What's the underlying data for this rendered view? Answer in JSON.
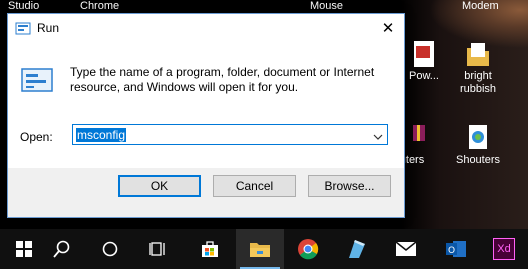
{
  "desktop": {
    "top_labels": [
      "Studio",
      "Chrome",
      "Mouse",
      "Modem"
    ],
    "icons": [
      {
        "label": "Pow...",
        "icon": "pdf-file-icon"
      },
      {
        "label": "bright rubbish",
        "icon": "folder-icon"
      },
      {
        "label": "uters",
        "icon": "archive-file-icon"
      },
      {
        "label": "Shouters",
        "icon": "web-document-icon"
      }
    ]
  },
  "run_dialog": {
    "title": "Run",
    "close_label": "✕",
    "description": "Type the name of a program, folder, document or Internet resource, and Windows will open it for you.",
    "open_label": "Open:",
    "open_value": "msconfig",
    "ok_label": "OK",
    "cancel_label": "Cancel",
    "browse_label": "Browse..."
  },
  "taskbar": {
    "items": [
      "start-icon",
      "search-icon",
      "cortana-icon",
      "task-view-icon",
      "store-icon",
      "file-explorer-icon",
      "chrome-icon",
      "notepad-icon",
      "mail-icon",
      "outlook-icon",
      "xd-icon"
    ],
    "xd_label": "Xd",
    "accent": "#76b9ed"
  }
}
